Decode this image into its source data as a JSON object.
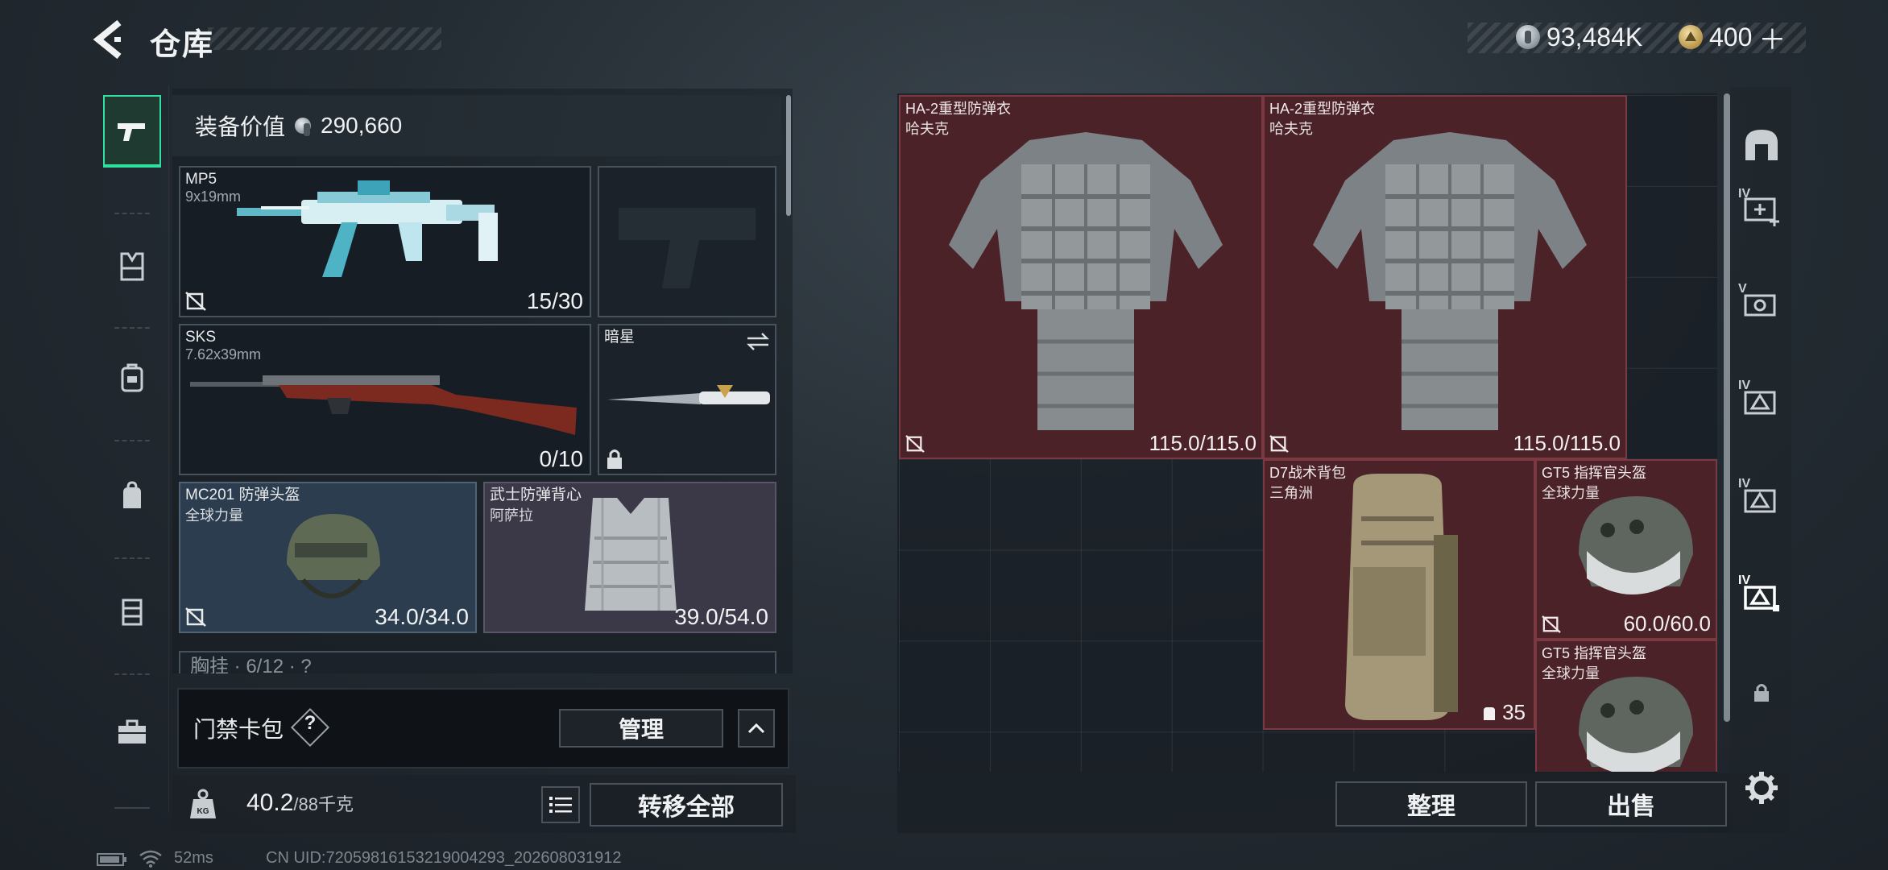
{
  "header": {
    "title": "仓库",
    "currency_primary": "93,484K",
    "currency_secondary": "400"
  },
  "equipment": {
    "value_label": "装备价值",
    "value": "290,660",
    "primary_weapon": {
      "name": "MP5",
      "ammo": "9x19mm",
      "count": "15/30"
    },
    "secondary_weapon": {
      "name": "SKS",
      "ammo": "7.62x39mm",
      "count": "0/10"
    },
    "melee": {
      "name": "暗星"
    },
    "helmet": {
      "name": "MC201 防弹头盔",
      "brand": "全球力量",
      "durability": "34.0/34.0"
    },
    "armor": {
      "name": "武士防弹背心",
      "brand": "阿萨拉",
      "durability": "39.0/54.0"
    },
    "chest_rig_partial": "胸挂 · 6/12 · ?"
  },
  "keycard": {
    "label": "门禁卡包",
    "help": "?",
    "manage_label": "管理"
  },
  "bottom_left": {
    "weight": "40.2",
    "weight_capacity": "/88千克",
    "transfer_label": "转移全部"
  },
  "status": {
    "ping": "52ms",
    "uid": "CN UID:72059816153219004293_202608031912"
  },
  "stash": {
    "items": [
      {
        "name": "HA-2重型防弹衣",
        "brand": "哈夫克",
        "durability": "115.0/115.0"
      },
      {
        "name": "HA-2重型防弹衣",
        "brand": "哈夫克",
        "durability": "115.0/115.0"
      },
      {
        "name": "D7战术背包",
        "brand": "三角洲",
        "capacity": "35"
      },
      {
        "name": "GT5 指挥官头盔",
        "brand": "全球力量",
        "durability": "60.0/60.0"
      },
      {
        "name": "GT5 指挥官头盔",
        "brand": "全球力量"
      }
    ],
    "arrange_label": "整理",
    "sell_label": "出售"
  },
  "right_rail": {
    "tiers": [
      "IV",
      "V",
      "IV",
      "IV",
      "IV"
    ]
  },
  "colors": {
    "accent": "#2fe0a0",
    "red_item": "#4a2227",
    "blue_item": "#2c3d4f",
    "purple_item": "#3b3847"
  }
}
